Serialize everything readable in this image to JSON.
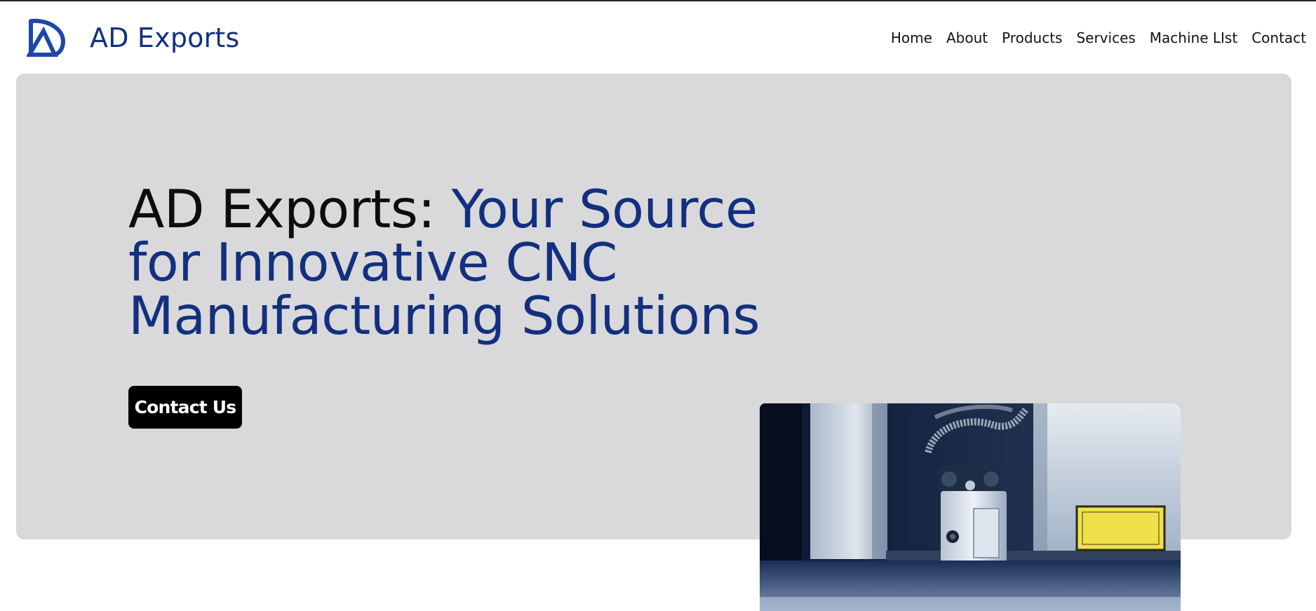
{
  "brand": {
    "name": "AD Exports",
    "logo_icon": "ad-monogram-icon"
  },
  "nav": {
    "items": [
      "Home",
      "About",
      "Products",
      "Services",
      "Machine LIst",
      "Contact"
    ]
  },
  "hero": {
    "headline_lead": "AD Exports: ",
    "headline_highlight": "Your Source for Innovative CNC Manufacturing Solutions",
    "cta_label": "Contact Us",
    "image": "cnc-laser-machine-photo"
  },
  "colors": {
    "brand": "#12307f",
    "hero_bg": "#d9d9db",
    "cta_bg": "#000000",
    "text": "#111111"
  }
}
